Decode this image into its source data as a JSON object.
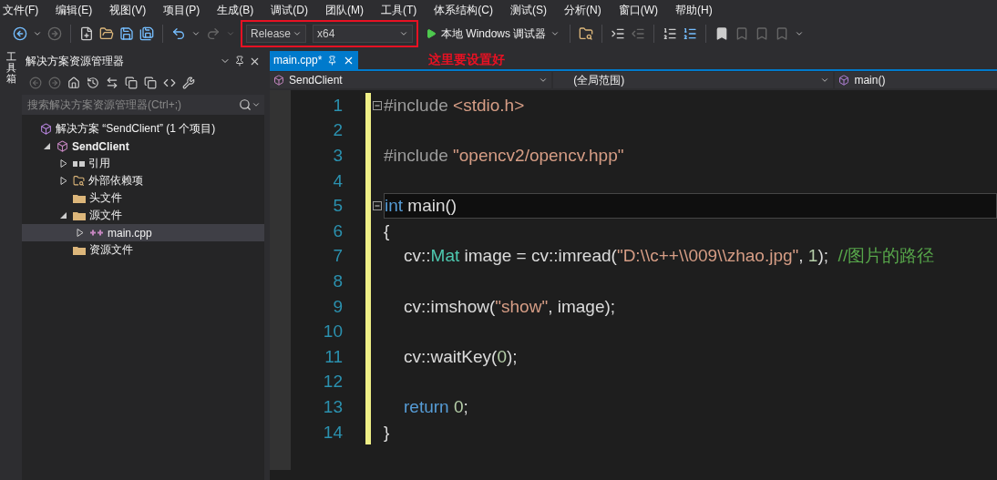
{
  "menu": [
    "文件(F)",
    "编辑(E)",
    "视图(V)",
    "项目(P)",
    "生成(B)",
    "调试(D)",
    "团队(M)",
    "工具(T)",
    "体系结构(C)",
    "测试(S)",
    "分析(N)",
    "窗口(W)",
    "帮助(H)"
  ],
  "toolbar": {
    "configuration": "Release",
    "platform": "x64",
    "debugger": "本地 Windows 调试器"
  },
  "annotation": {
    "text": "这里要设置好"
  },
  "toolbox_tab": "工具箱",
  "solution_explorer": {
    "title": "解决方案资源管理器",
    "search": {
      "placeholder": "搜索解决方案资源管理器(Ctrl+;)"
    },
    "tree": [
      {
        "kind": "solution",
        "label": "解决方案 “SendClient” (1 个项目)",
        "selected": false,
        "children": [
          {
            "kind": "project",
            "label": "SendClient",
            "selected": false,
            "expanded": true,
            "children": [
              {
                "kind": "references",
                "label": "引用",
                "selected": false,
                "expanded": false
              },
              {
                "kind": "external",
                "label": "外部依赖项",
                "selected": false,
                "expanded": false
              },
              {
                "kind": "folder",
                "label": "头文件",
                "selected": false
              },
              {
                "kind": "folder",
                "label": "源文件",
                "selected": false,
                "expanded": true,
                "children": [
                  {
                    "kind": "file",
                    "label": "main.cpp",
                    "selected": true,
                    "expanded": false
                  }
                ]
              },
              {
                "kind": "folder",
                "label": "资源文件",
                "selected": false
              }
            ]
          }
        ]
      }
    ]
  },
  "editor": {
    "tabs": [
      {
        "label": "main.cpp*",
        "selected": true
      }
    ],
    "nav": {
      "project": "SendClient",
      "scope": "(全局范围)",
      "member": "main()"
    },
    "lines": [
      {
        "number": "1",
        "fold": true,
        "current": false,
        "indent": false,
        "tokens": [
          {
            "kind": "pre",
            "text": "#include "
          },
          {
            "kind": "string",
            "text": "<stdio.h>"
          }
        ]
      },
      {
        "number": "2",
        "fold": false,
        "current": false
      },
      {
        "number": "3",
        "fold": false,
        "current": false,
        "indent": false,
        "tokens": [
          {
            "kind": "pre",
            "text": "#include "
          },
          {
            "kind": "string",
            "text": "\"opencv2/opencv.hpp\""
          }
        ]
      },
      {
        "number": "4",
        "fold": false,
        "current": false
      },
      {
        "number": "5",
        "fold": true,
        "current": true,
        "indent": false,
        "tokens": [
          {
            "kind": "keyword",
            "text": "int"
          },
          {
            "kind": "plain",
            "text": " main()"
          }
        ]
      },
      {
        "number": "6",
        "fold": false,
        "current": false,
        "indent": false,
        "tokens": [
          {
            "kind": "plain",
            "text": "{"
          }
        ]
      },
      {
        "number": "7",
        "fold": false,
        "current": false,
        "indent": true,
        "tokens": [
          {
            "kind": "plain",
            "text": "cv::"
          },
          {
            "kind": "type",
            "text": "Mat"
          },
          {
            "kind": "plain",
            "text": " image = cv::imread("
          },
          {
            "kind": "string",
            "text": "\"D:\\\\c++\\\\009\\\\zhao.jpg\""
          },
          {
            "kind": "plain",
            "text": ", "
          },
          {
            "kind": "number",
            "text": "1"
          },
          {
            "kind": "plain",
            "text": ");  "
          },
          {
            "kind": "comment",
            "text": "//图片的路径"
          }
        ]
      },
      {
        "number": "8",
        "fold": false,
        "current": false
      },
      {
        "number": "9",
        "fold": false,
        "current": false,
        "indent": true,
        "tokens": [
          {
            "kind": "plain",
            "text": "cv::imshow("
          },
          {
            "kind": "string",
            "text": "\"show\""
          },
          {
            "kind": "plain",
            "text": ", image);"
          }
        ]
      },
      {
        "number": "10",
        "fold": false,
        "current": false
      },
      {
        "number": "11",
        "fold": false,
        "current": false,
        "indent": true,
        "tokens": [
          {
            "kind": "plain",
            "text": "cv::waitKey("
          },
          {
            "kind": "number",
            "text": "0"
          },
          {
            "kind": "plain",
            "text": ");"
          }
        ]
      },
      {
        "number": "12",
        "fold": false,
        "current": false
      },
      {
        "number": "13",
        "fold": false,
        "current": false,
        "indent": true,
        "tokens": [
          {
            "kind": "keyword",
            "text": "return "
          },
          {
            "kind": "number",
            "text": "0"
          },
          {
            "kind": "plain",
            "text": ";"
          }
        ]
      },
      {
        "number": "14",
        "fold": false,
        "current": false,
        "indent": false,
        "tokens": [
          {
            "kind": "plain",
            "text": "}"
          }
        ]
      }
    ]
  }
}
